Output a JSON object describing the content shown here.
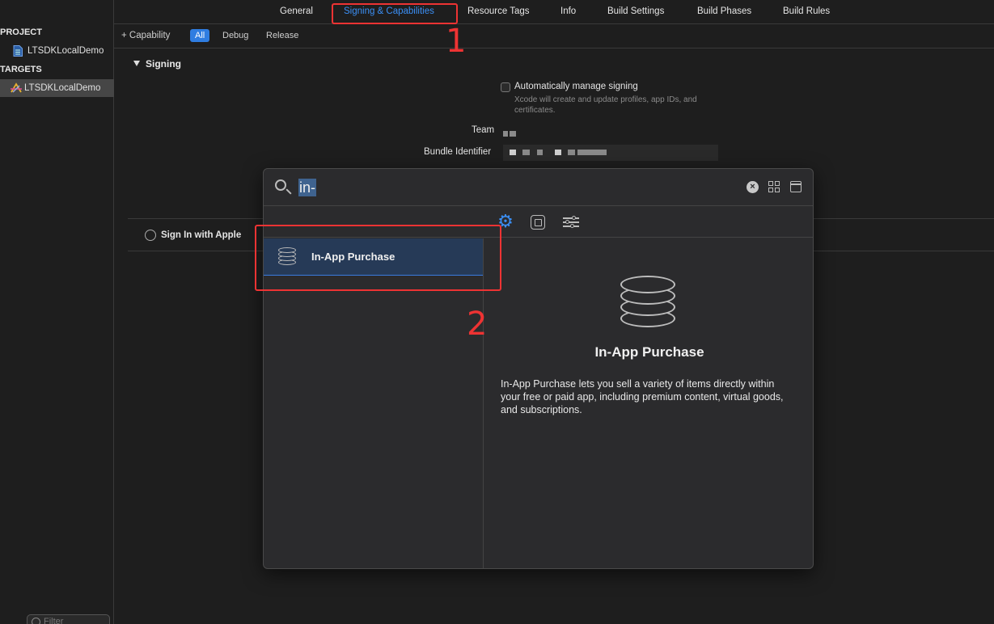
{
  "sidebar": {
    "project_header": "PROJECT",
    "project_item": "LTSDKLocalDemo",
    "targets_header": "TARGETS",
    "target_item": "LTSDKLocalDemo",
    "filter_placeholder": "Filter"
  },
  "tabs": [
    {
      "label": "General"
    },
    {
      "label": "Signing & Capabilities"
    },
    {
      "label": "Resource Tags"
    },
    {
      "label": "Info"
    },
    {
      "label": "Build Settings"
    },
    {
      "label": "Build Phases"
    },
    {
      "label": "Build Rules"
    }
  ],
  "active_tab": "Signing & Capabilities",
  "subbar": {
    "capability_label": "+ Capability",
    "configs": [
      "All",
      "Debug",
      "Release"
    ],
    "selected_config": "All"
  },
  "signing": {
    "heading": "Signing",
    "auto_manage_label": "Automatically manage signing",
    "auto_manage_checked": false,
    "auto_manage_help": "Xcode will create and update profiles, app IDs, and certificates.",
    "team_label": "Team",
    "bundle_id_label": "Bundle Identifier"
  },
  "sign_in_with_apple": "Sign In with Apple",
  "popover": {
    "search_value": "in-",
    "results": [
      {
        "label": "In-App Purchase",
        "icon": "coins-icon"
      }
    ],
    "detail": {
      "title": "In-App Purchase",
      "description": "In-App Purchase lets you sell a variety of items directly within your free or paid app, including premium content, virtual goods, and subscriptions."
    }
  },
  "annotations": {
    "step1": "1",
    "step2": "2",
    "color": "#e33333"
  },
  "colors": {
    "accent": "#3b8ff5",
    "selection": "#263a57",
    "background": "#1e1e1e"
  }
}
